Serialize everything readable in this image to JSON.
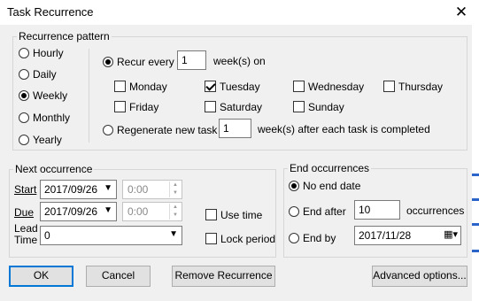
{
  "window": {
    "title": "Task Recurrence",
    "close_glyph": "✕"
  },
  "recurrence_pattern": {
    "legend": "Recurrence pattern",
    "frequencies": [
      {
        "label": "Hourly",
        "selected": false
      },
      {
        "label": "Daily",
        "selected": false
      },
      {
        "label": "Weekly",
        "selected": true
      },
      {
        "label": "Monthly",
        "selected": false
      },
      {
        "label": "Yearly",
        "selected": false
      }
    ],
    "recur_every_label": "Recur every",
    "recur_every_value": "1",
    "recur_suffix": "week(s) on",
    "days": [
      {
        "label": "Monday",
        "checked": false
      },
      {
        "label": "Tuesday",
        "checked": true
      },
      {
        "label": "Wednesday",
        "checked": false
      },
      {
        "label": "Thursday",
        "checked": false
      },
      {
        "label": "Friday",
        "checked": false
      },
      {
        "label": "Saturday",
        "checked": false
      },
      {
        "label": "Sunday",
        "checked": false
      }
    ],
    "regenerate_label": "Regenerate new task",
    "regenerate_value": "1",
    "regenerate_suffix": "week(s) after each task is completed"
  },
  "next_occurrence": {
    "legend": "Next occurrence",
    "start_label": "Start",
    "start_date": "2017/09/26",
    "start_time": "0:00",
    "due_label": "Due",
    "due_date": "2017/09/26",
    "due_time": "0:00",
    "lead_label_1": "Lead",
    "lead_label_2": "Time",
    "lead_value": "0",
    "use_time_label": "Use time",
    "lock_period_label": "Lock period"
  },
  "end_occurrences": {
    "legend": "End occurrences",
    "no_end_label": "No end date",
    "end_after_label": "End after",
    "end_after_value": "10",
    "occurrences_label": "occurrences",
    "end_by_label": "End by",
    "end_by_value": "2017/11/28"
  },
  "buttons": {
    "ok": "OK",
    "cancel": "Cancel",
    "remove": "Remove Recurrence",
    "advanced": "Advanced options..."
  },
  "colors": {
    "accent": "#0078d7",
    "background": "#f0f0f0",
    "strip_accent": "#2a64c8"
  }
}
